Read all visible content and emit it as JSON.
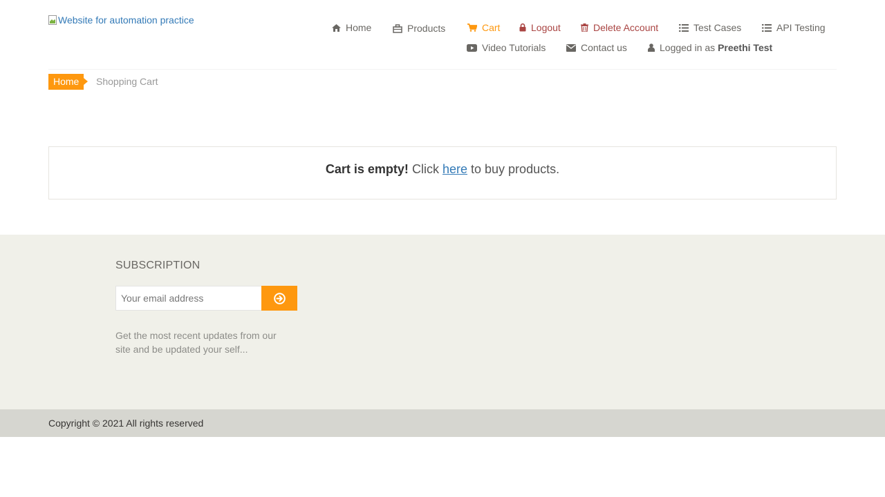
{
  "header": {
    "logo_alt": "Website for automation practice"
  },
  "nav": {
    "home": "Home",
    "products": "Products",
    "cart": "Cart",
    "logout": "Logout",
    "delete_account": "Delete Account",
    "test_cases": "Test Cases",
    "api_testing": "API Testing",
    "video_tutorials": "Video Tutorials",
    "contact_us": "Contact us",
    "logged_in_prefix": "Logged in as",
    "logged_in_user": "Preethi Test"
  },
  "breadcrumb": {
    "home": "Home",
    "current": "Shopping Cart"
  },
  "cart": {
    "empty_bold": "Cart is empty!",
    "click": "Click",
    "link": "here",
    "suffix": "to buy products."
  },
  "subscription": {
    "title": "SUBSCRIPTION",
    "placeholder": "Your email address",
    "note": "Get the most recent updates from our site and be updated your self..."
  },
  "footer": {
    "copyright": "Copyright © 2021 All rights reserved"
  },
  "colors": {
    "accent": "#fe980f",
    "danger": "#a94442",
    "link": "#337ab7",
    "footer_bg": "#f0f0e9",
    "footer_bottom_bg": "#d6d6d0"
  }
}
